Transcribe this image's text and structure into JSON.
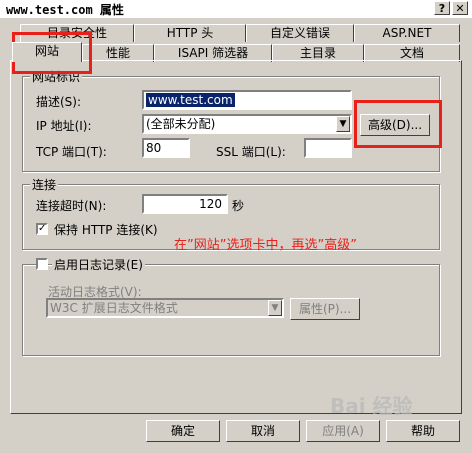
{
  "window": {
    "title": "www.test.com 属性",
    "help_glyph": "?",
    "close_glyph": "✕"
  },
  "tabs": {
    "row1": [
      "目录安全性",
      "HTTP 头",
      "自定义错误",
      "ASP.NET"
    ],
    "row2": [
      "网站",
      "性能",
      "ISAPI 筛选器",
      "主目录",
      "文档"
    ],
    "active": "网站"
  },
  "website_id": {
    "group_label": "网站标识",
    "description_label": "描述(S):",
    "description_value": "www.test.com",
    "ip_label": "IP 地址(I):",
    "ip_value": "(全部未分配)",
    "tcp_label": "TCP 端口(T):",
    "tcp_value": "80",
    "ssl_label": "SSL 端口(L):",
    "ssl_value": "",
    "advanced_button": "高级(D)..."
  },
  "connection": {
    "group_label": "连接",
    "timeout_label": "连接超时(N):",
    "timeout_value": "120",
    "timeout_unit": "秒",
    "keepalive_label": "保持 HTTP 连接(K)",
    "keepalive_checked": true
  },
  "annotation": "在”网站”选项卡中，再选”高级”",
  "logging": {
    "enable_label": "启用日志记录(E)",
    "enabled": false,
    "format_label": "活动日志格式(V):",
    "format_value": "W3C 扩展日志文件格式",
    "properties_button": "属性(P)..."
  },
  "footer": {
    "ok": "确定",
    "cancel": "取消",
    "apply": "应用(A)",
    "help": "帮助"
  },
  "watermark": "Bai 经验",
  "colors": {
    "face": "#d4d0c8",
    "highlight_box": "#e8201a",
    "selection": "#0a246a"
  }
}
